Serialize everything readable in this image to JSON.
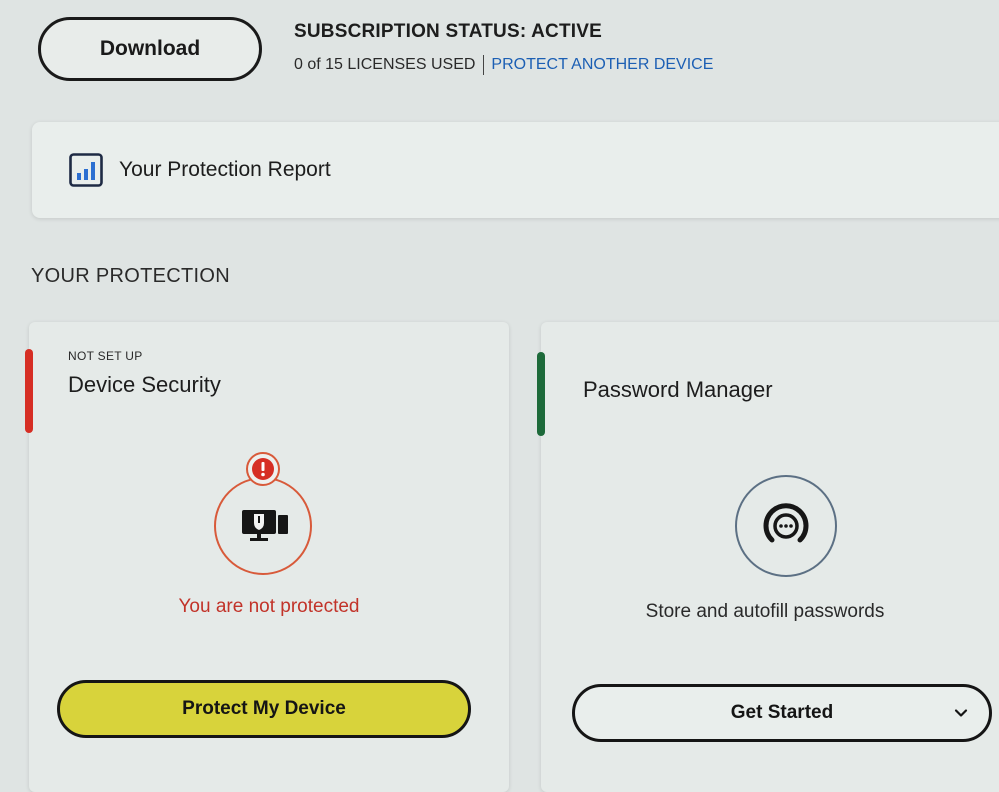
{
  "header": {
    "download_label": "Download",
    "subscription_status": "SUBSCRIPTION STATUS: ACTIVE",
    "licenses_used": "0 of 15 LICENSES USED",
    "protect_another_device": "PROTECT ANOTHER DEVICE"
  },
  "report": {
    "icon": "bar-chart-icon",
    "label": "Your Protection Report"
  },
  "section": {
    "heading": "YOUR PROTECTION"
  },
  "cards": [
    {
      "status": "NOT SET UP",
      "title": "Device Security",
      "icon": "monitor-shield-icon",
      "alert_icon": "alert-icon",
      "message": "You are not protected",
      "button_label": "Protect My Device",
      "status_color": "#d62e24"
    },
    {
      "title": "Password Manager",
      "icon": "password-dots-icon",
      "message": "Store and autofill passwords",
      "button_label": "Get Started",
      "button_icon": "chevron-down-icon",
      "status_color": "#1d6a3a"
    }
  ],
  "colors": {
    "accent_yellow": "#d8d33b",
    "link_blue": "#1c5fb4",
    "alert_red": "#d62e24",
    "ok_green": "#1d6a3a"
  }
}
